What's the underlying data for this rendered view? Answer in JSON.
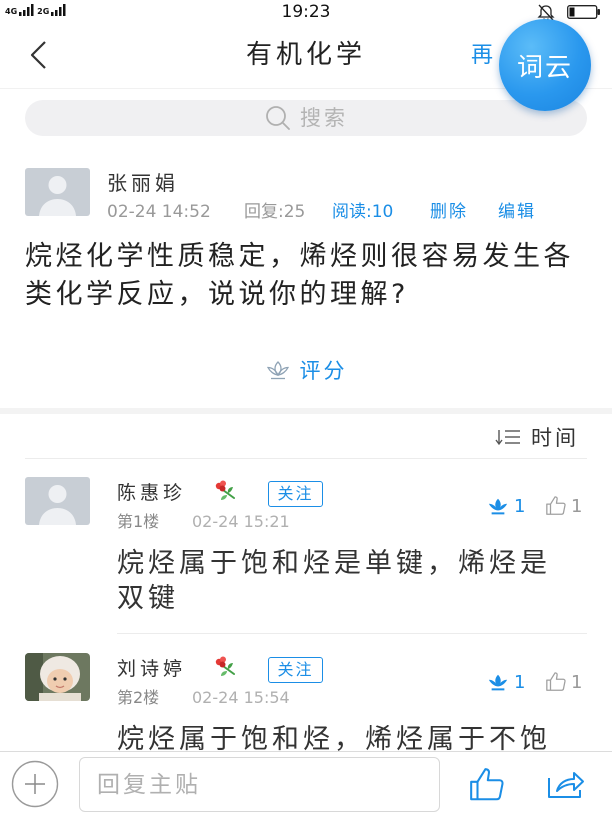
{
  "status_bar": {
    "network_labels": [
      "4G",
      "2G"
    ],
    "time": "19:23"
  },
  "nav": {
    "title": "有机化学",
    "right_action": "再",
    "word_cloud_button": "词云"
  },
  "search": {
    "placeholder": "搜索"
  },
  "post": {
    "author": "张丽娟",
    "time": "02-24 14:52",
    "replies": "回复:25",
    "reads": "阅读:10",
    "delete": "删除",
    "edit": "编辑",
    "content": "烷烃化学性质稳定，烯烃则很容易发生各类化学反应，说说你的理解?",
    "rate_label": "评分"
  },
  "sort": {
    "label": "时间"
  },
  "comments": [
    {
      "author": "陈惠珍",
      "follow": "关注",
      "floor": "第1楼",
      "time": "02-24 15:21",
      "rating": "1",
      "likes": "1",
      "content": "烷烃属于饱和烃是单键，烯烃是双键"
    },
    {
      "author": "刘诗婷",
      "follow": "关注",
      "floor": "第2楼",
      "time": "02-24 15:54",
      "rating": "1",
      "likes": "1",
      "content": "烷烃属于饱和烃，烯烃属于不饱"
    }
  ],
  "bottom_bar": {
    "reply_placeholder": "回复主贴"
  },
  "colors": {
    "accent": "#1b8ee6",
    "text": "#222222",
    "muted": "#999999",
    "search_bg": "#f0f0f2"
  }
}
